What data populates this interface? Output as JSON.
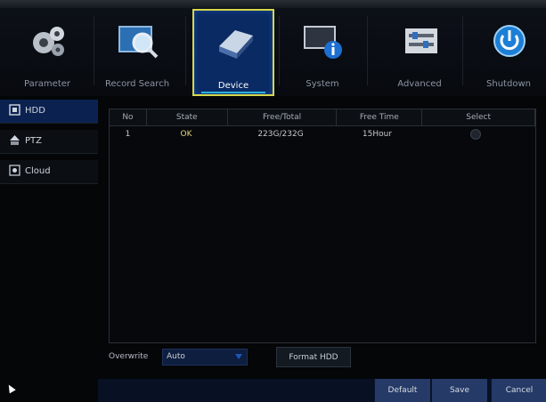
{
  "tabs": [
    {
      "label": "Parameter",
      "icon": "gears-icon",
      "active": false
    },
    {
      "label": "Record Search",
      "icon": "magnifier-icon",
      "active": false
    },
    {
      "label": "Device",
      "icon": "hdd-icon",
      "active": true
    },
    {
      "label": "System",
      "icon": "system-info-icon",
      "active": false
    },
    {
      "label": "Advanced",
      "icon": "advanced-panel-icon",
      "active": false
    },
    {
      "label": "Shutdown",
      "icon": "power-icon",
      "active": false
    }
  ],
  "sidebar": {
    "items": [
      {
        "label": "HDD",
        "icon": "hdd-small-icon",
        "active": true
      },
      {
        "label": "PTZ",
        "icon": "ptz-camera-icon",
        "active": false
      },
      {
        "label": "Cloud",
        "icon": "cloud-icon",
        "active": false
      }
    ]
  },
  "table": {
    "headers": [
      "No",
      "State",
      "Free/Total",
      "Free Time",
      "Select"
    ],
    "rows": [
      {
        "no": "1",
        "state": "OK",
        "free_total": "223G/232G",
        "free_time": "15Hour"
      }
    ]
  },
  "overwrite": {
    "label": "Overwrite",
    "value": "Auto"
  },
  "format_button": "Format HDD",
  "footer": {
    "default": "Default",
    "save": "Save",
    "cancel": "Cancel"
  },
  "colors": {
    "active_tab_bg": "#0a2a63",
    "active_border": "#d7d84a",
    "state_ok": "#e6d77a",
    "footer_btn": "#253a66"
  }
}
